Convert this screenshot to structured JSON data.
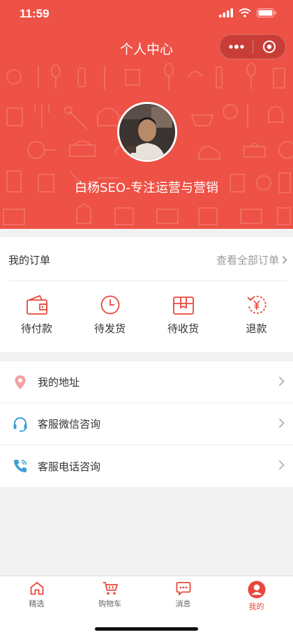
{
  "status_bar": {
    "time": "11:59"
  },
  "nav": {
    "title": "个人中心"
  },
  "profile": {
    "nickname": "白杨SEO-专注运营与营销"
  },
  "orders": {
    "title": "我的订单",
    "view_all": "查看全部订单",
    "tabs": [
      {
        "label": "待付款",
        "icon": "wallet-icon"
      },
      {
        "label": "待发货",
        "icon": "clock-icon"
      },
      {
        "label": "待收货",
        "icon": "package-icon"
      },
      {
        "label": "退款",
        "icon": "refund-yen-icon"
      }
    ]
  },
  "menu": [
    {
      "label": "我的地址",
      "icon": "location-pin-icon"
    },
    {
      "label": "客服微信咨询",
      "icon": "headset-icon"
    },
    {
      "label": "客服电话咨询",
      "icon": "phone-icon"
    }
  ],
  "tabbar": {
    "items": [
      {
        "label": "精选",
        "icon": "home-icon"
      },
      {
        "label": "购物车",
        "icon": "cart-icon"
      },
      {
        "label": "消息",
        "icon": "message-icon"
      },
      {
        "label": "我的",
        "icon": "user-icon",
        "active": true
      }
    ]
  },
  "colors": {
    "brand": "#ee5145",
    "accent": "#e8473b",
    "page_bg": "#f2f2f2"
  }
}
